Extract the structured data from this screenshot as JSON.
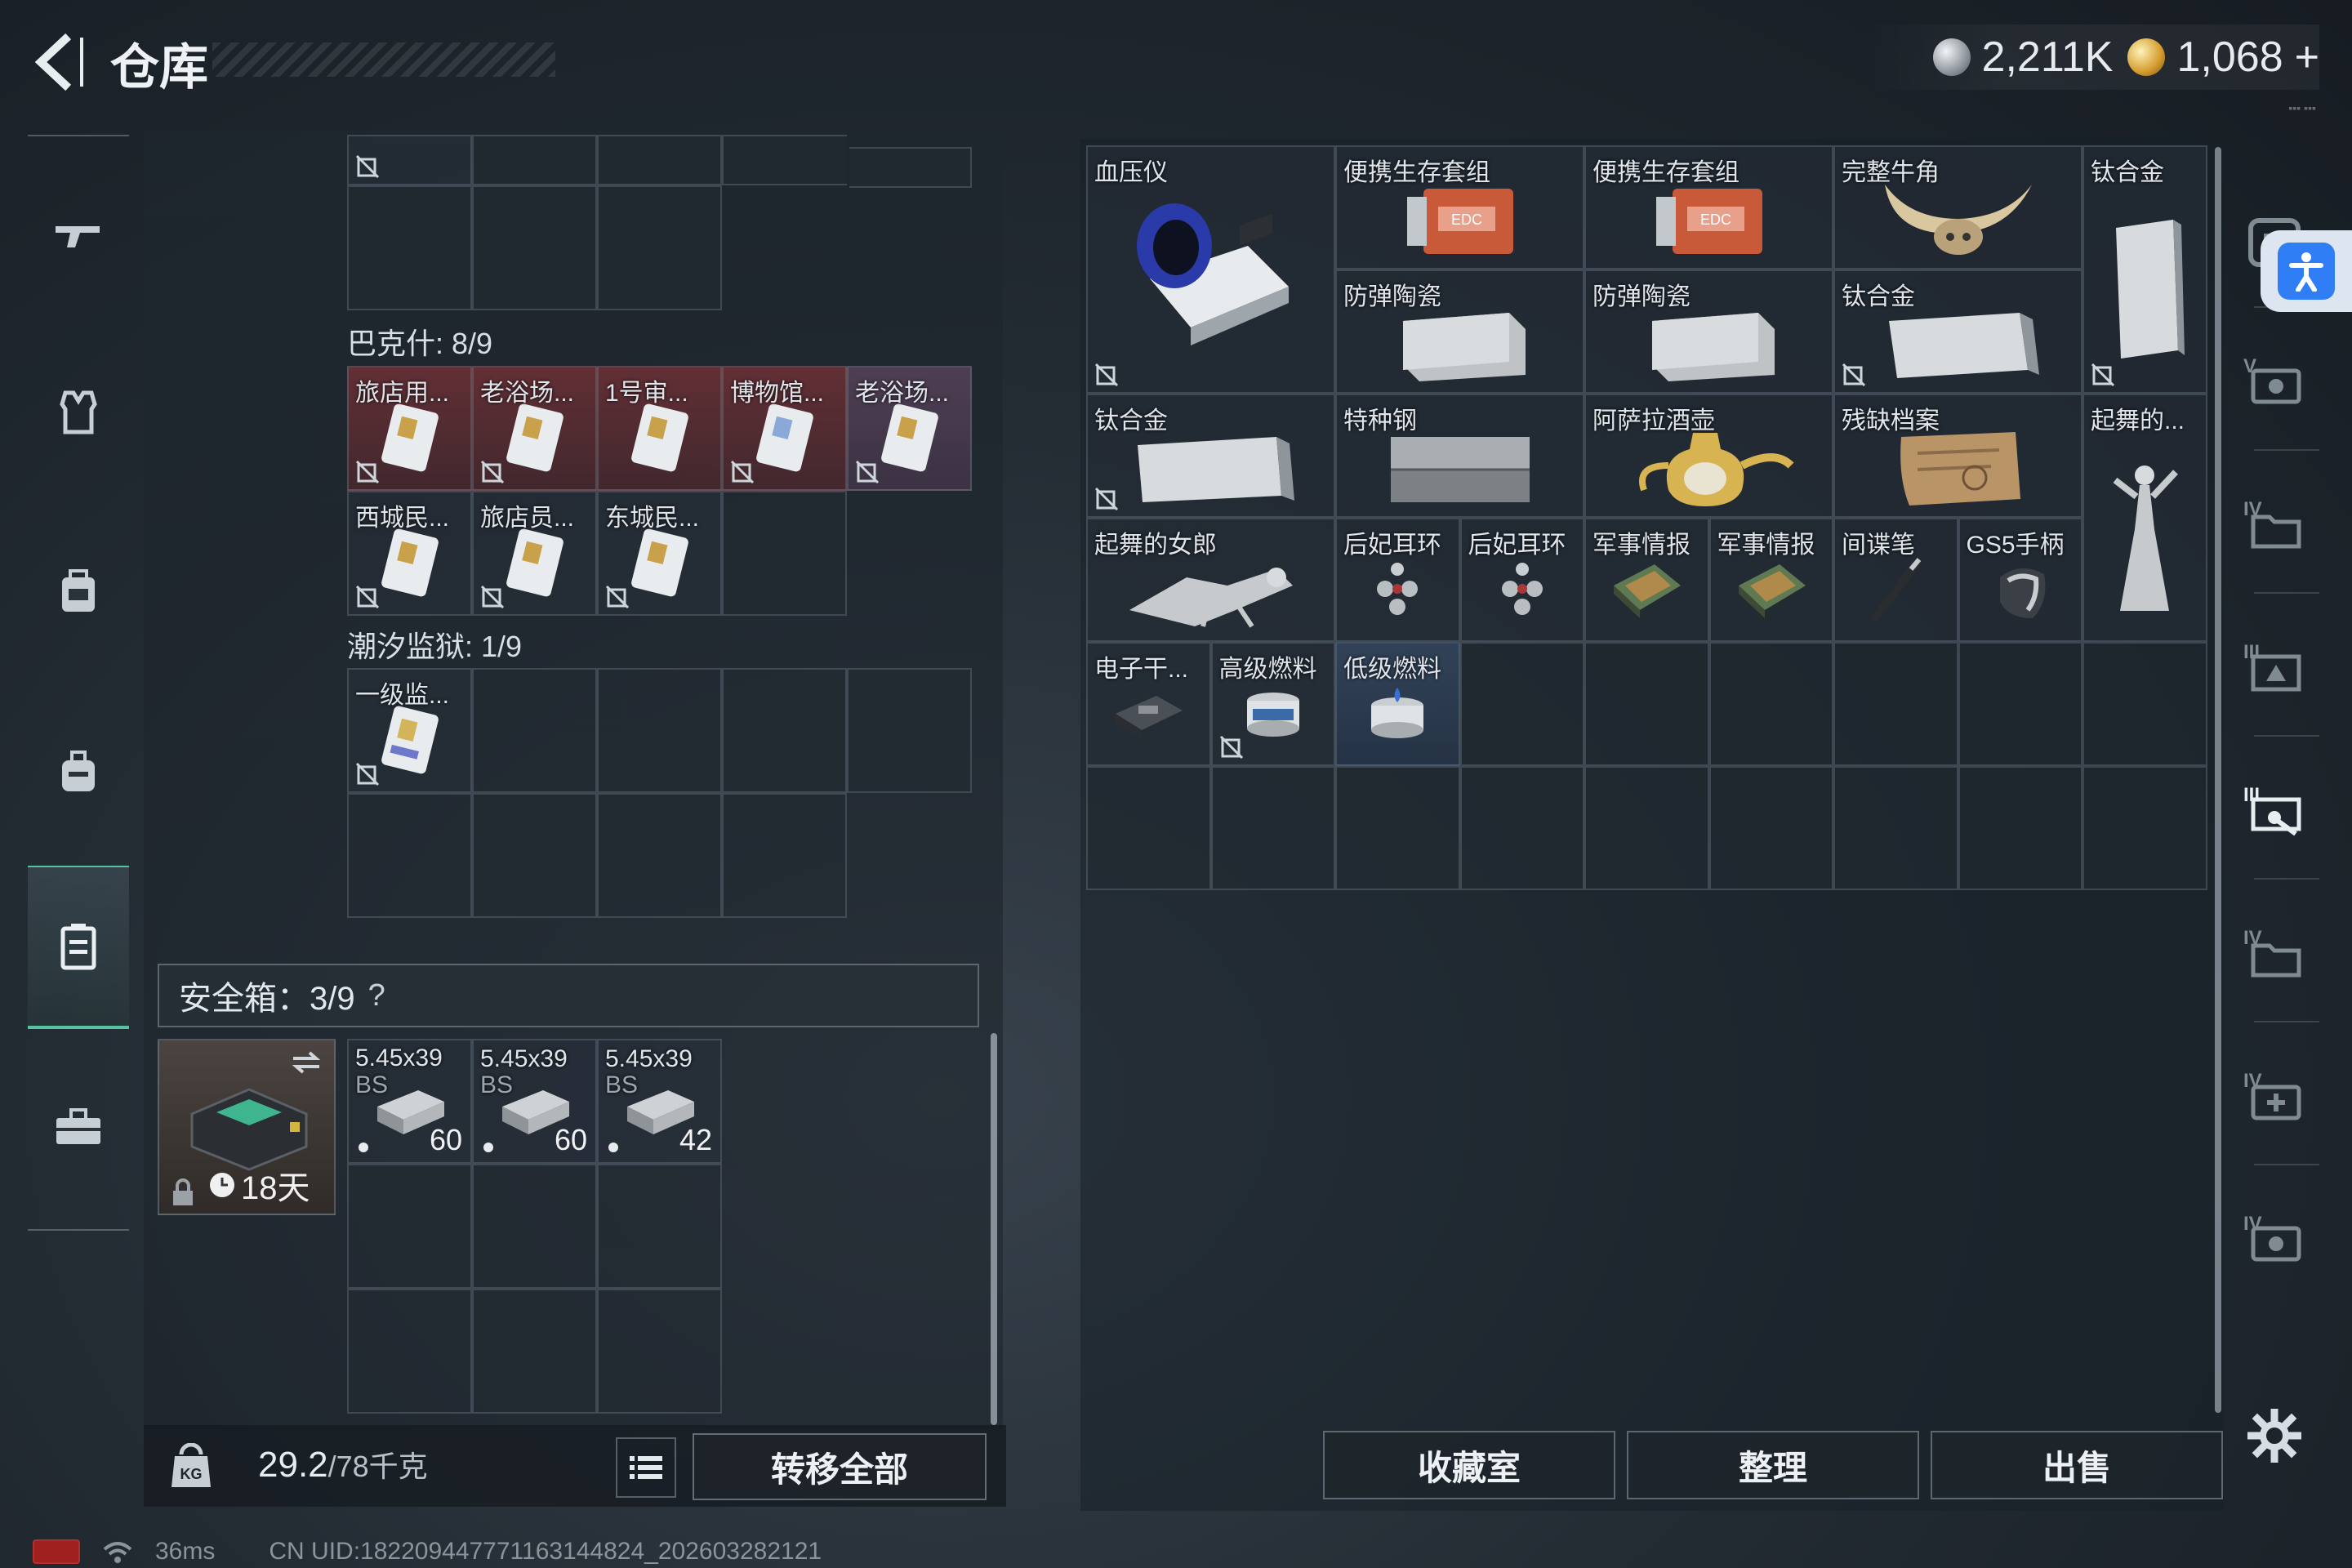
{
  "header": {
    "title": "仓库",
    "currency_silver": "2,211K",
    "currency_gold": "1,068",
    "currency_add": "+"
  },
  "left_sections": {
    "backpack_overflow": {
      "label": ""
    },
    "bakshi": {
      "label": "巴克什: 8/9",
      "items": [
        "旅店用...",
        "老浴场...",
        "1号审...",
        "博物馆...",
        "老浴场...",
        "西城民...",
        "旅店员...",
        "东城民..."
      ]
    },
    "prison": {
      "label": "潮汐监狱: 1/9",
      "items": [
        "一级监..."
      ]
    },
    "safe": {
      "label": "安全箱：3/9",
      "help": "?",
      "days": "18天",
      "ammo": [
        {
          "name": "5.45x39",
          "sub": "BS",
          "count": "60"
        },
        {
          "name": "5.45x39",
          "sub": "BS",
          "count": "60"
        },
        {
          "name": "5.45x39",
          "sub": "BS",
          "count": "42"
        }
      ]
    }
  },
  "footer_left": {
    "weight": "29.2",
    "weight_max": "/78千克",
    "transfer_all": "转移全部"
  },
  "stash": {
    "items": [
      "血压仪",
      "便携生存套组",
      "便携生存套组",
      "完整牛角",
      "钛合金",
      "防弹陶瓷",
      "防弹陶瓷",
      "钛合金",
      "钛合金",
      "特种钢",
      "阿萨拉酒壶",
      "残缺档案",
      "起舞的...",
      "起舞的女郎",
      "后妃耳环",
      "后妃耳环",
      "军事情报",
      "军事情报",
      "间谍笔",
      "GS5手柄",
      "电子干...",
      "高级燃料",
      "低级燃料"
    ]
  },
  "footer_right": {
    "collection": "收藏室",
    "sort": "整理",
    "sell": "出售"
  },
  "status": {
    "ping": "36ms",
    "uid": "CN UID:18220944777116314482​4_202603282121"
  },
  "colors": {
    "accent_green": "#55c3a0",
    "rarity_red": "#78323a",
    "rarity_blue": "#3c506e"
  }
}
